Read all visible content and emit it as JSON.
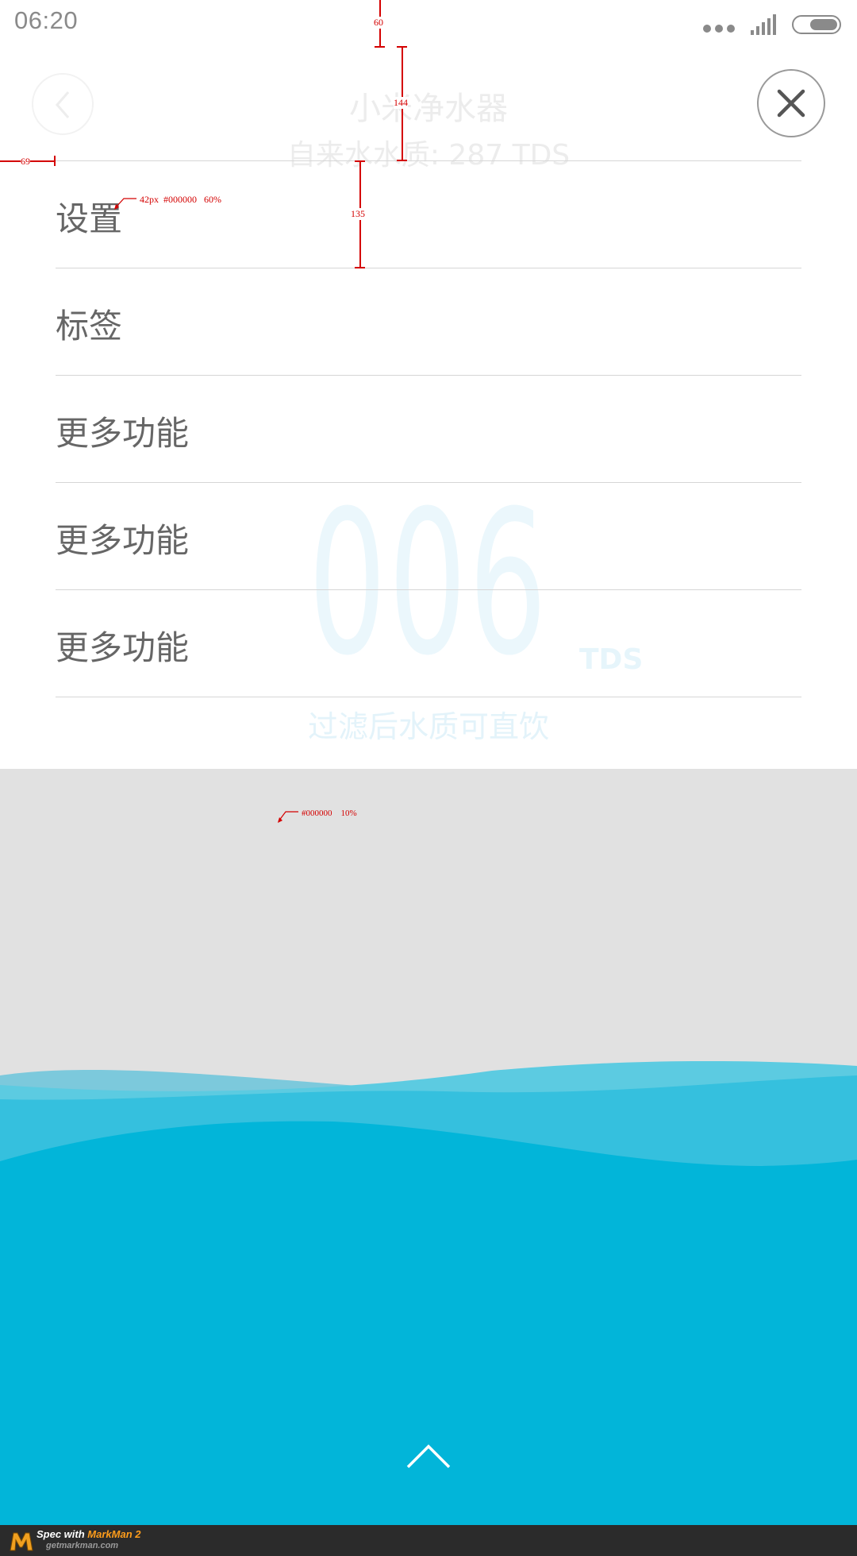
{
  "status_bar": {
    "time": "06:20",
    "icons": [
      "more-dots-icon",
      "signal-icon",
      "battery-icon"
    ]
  },
  "background_app": {
    "title": "小米净水器",
    "subtitle": "自来水水质: 287 TDS",
    "tds_value": "006",
    "tds_unit": "TDS",
    "status_note": "过滤后水质可直饮"
  },
  "menu": {
    "items": [
      {
        "label": "设置"
      },
      {
        "label": "标签"
      },
      {
        "label": "更多功能"
      },
      {
        "label": "更多功能"
      },
      {
        "label": "更多功能"
      }
    ]
  },
  "colors": {
    "menu_text": "#000000",
    "overlay_dim": "#000000",
    "water_primary": "#02b5d9",
    "water_secondary": "#35c0de",
    "water_light": "#5ccbe1",
    "annotation": "#d40000"
  },
  "annotations": {
    "status_gap": "60",
    "header_height": "144",
    "left_margin": "69",
    "row_height": "135",
    "menu_font_spec": "42px  #000000   60%",
    "dim_spec": "#000000    10%"
  },
  "footer": {
    "brand_prefix": "Spec with ",
    "brand_name": "MarkMan 2",
    "url": "getmarkman.com"
  }
}
